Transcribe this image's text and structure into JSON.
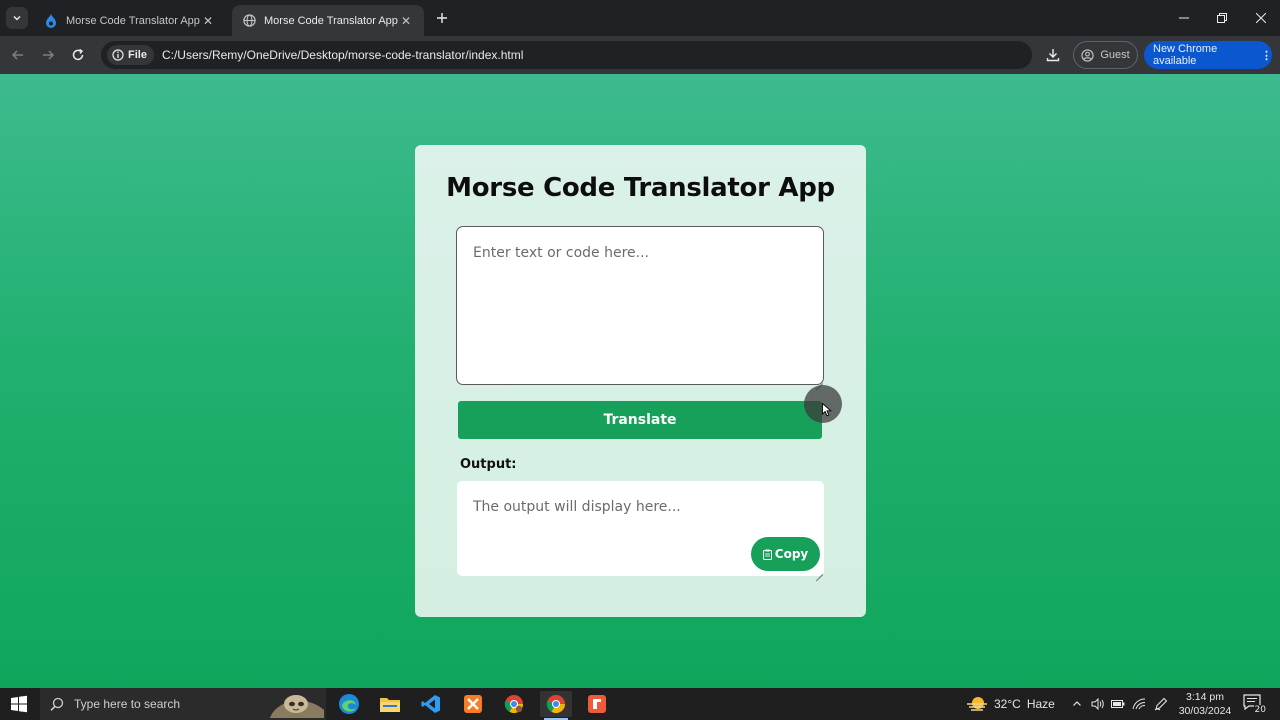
{
  "browser": {
    "tabs": [
      {
        "title": "Morse Code Translator App Usi",
        "active": false
      },
      {
        "title": "Morse Code Translator App",
        "active": true
      }
    ],
    "address": {
      "scheme_label": "File",
      "url": "C:/Users/Remy/OneDrive/Desktop/morse-code-translator/index.html"
    },
    "profile_label": "Guest",
    "update_label": "New Chrome available"
  },
  "app": {
    "title": "Morse Code Translator App",
    "input_placeholder": "Enter text or code here...",
    "translate_label": "Translate",
    "output_label": "Output:",
    "output_placeholder": "The output will display here...",
    "copy_label": "Copy"
  },
  "taskbar": {
    "search_placeholder": "Type here to search",
    "weather": {
      "temp": "32°C",
      "condition": "Haze"
    },
    "clock": {
      "time": "3:14 pm",
      "date": "30/03/2024"
    },
    "notifications": "20"
  },
  "colors": {
    "accent": "#16a05a",
    "page_top": "#3dbb8e",
    "page_bottom": "#0fa65c",
    "card": "#d8f0e6"
  }
}
